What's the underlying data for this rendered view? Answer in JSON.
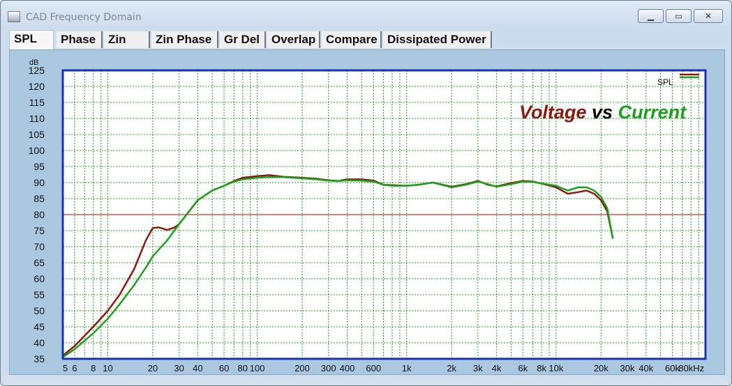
{
  "window": {
    "title": "CAD Frequency Domain"
  },
  "tabs": [
    "SPL",
    "Phase",
    "Zin",
    "Zin Phase",
    "Gr Del",
    "Overlap",
    "Compare",
    "Dissipated Power"
  ],
  "active_tab": "SPL",
  "annotation": {
    "part1": "Voltage",
    "part2": " vs ",
    "part3": "Current"
  },
  "colors": {
    "voltage": "#8b1a10",
    "current": "#1ea01e",
    "grid": "#1a9a1a",
    "reference": "#c0392b",
    "frame": "#1833b0"
  },
  "chart_data": {
    "type": "line",
    "title": "",
    "ylabel": "dB",
    "xlabel": "",
    "x_scale": "log",
    "xlim": [
      5,
      100000
    ],
    "ylim": [
      35,
      125
    ],
    "y_ticks": [
      35,
      40,
      45,
      50,
      55,
      60,
      65,
      70,
      75,
      80,
      85,
      90,
      95,
      100,
      105,
      110,
      115,
      120,
      125
    ],
    "x_tick_labels": [
      {
        "x": 5,
        "label": "5"
      },
      {
        "x": 6,
        "label": "6"
      },
      {
        "x": 8,
        "label": "8"
      },
      {
        "x": 10,
        "label": "10"
      },
      {
        "x": 20,
        "label": "20"
      },
      {
        "x": 30,
        "label": "30"
      },
      {
        "x": 40,
        "label": "40"
      },
      {
        "x": 60,
        "label": "60"
      },
      {
        "x": 80,
        "label": "80"
      },
      {
        "x": 100,
        "label": "100"
      },
      {
        "x": 200,
        "label": "200"
      },
      {
        "x": 300,
        "label": "300"
      },
      {
        "x": 400,
        "label": "400"
      },
      {
        "x": 600,
        "label": "600"
      },
      {
        "x": 1000,
        "label": "1k"
      },
      {
        "x": 2000,
        "label": "2k"
      },
      {
        "x": 3000,
        "label": "3k"
      },
      {
        "x": 4000,
        "label": "4k"
      },
      {
        "x": 6000,
        "label": "6k"
      },
      {
        "x": 8000,
        "label": "8k"
      },
      {
        "x": 10000,
        "label": "10k"
      },
      {
        "x": 20000,
        "label": "20k"
      },
      {
        "x": 30000,
        "label": "30k"
      },
      {
        "x": 40000,
        "label": "40k"
      },
      {
        "x": 60000,
        "label": "60k"
      },
      {
        "x": 80000,
        "label": "80kHz"
      }
    ],
    "reference_line": 80,
    "legend": {
      "label": "SPL",
      "position": "top-right"
    },
    "grid": true,
    "series": [
      {
        "name": "Voltage",
        "color": "#8b1a10",
        "points": [
          [
            5,
            36
          ],
          [
            6,
            39
          ],
          [
            8,
            45
          ],
          [
            10,
            50
          ],
          [
            12,
            55
          ],
          [
            15,
            63
          ],
          [
            18,
            72
          ],
          [
            20,
            75.8
          ],
          [
            22,
            76
          ],
          [
            25,
            75.2
          ],
          [
            28,
            76
          ],
          [
            30,
            77
          ],
          [
            35,
            81
          ],
          [
            40,
            84.5
          ],
          [
            50,
            87.5
          ],
          [
            60,
            89
          ],
          [
            70,
            90.5
          ],
          [
            80,
            91.5
          ],
          [
            100,
            92
          ],
          [
            120,
            92.3
          ],
          [
            150,
            91.8
          ],
          [
            200,
            91.5
          ],
          [
            250,
            91.2
          ],
          [
            300,
            90.7
          ],
          [
            350,
            90.5
          ],
          [
            400,
            91
          ],
          [
            500,
            91
          ],
          [
            600,
            90.6
          ],
          [
            700,
            89.3
          ],
          [
            800,
            89.2
          ],
          [
            1000,
            89
          ],
          [
            1200,
            89.3
          ],
          [
            1500,
            90
          ],
          [
            2000,
            88.7
          ],
          [
            2500,
            89.5
          ],
          [
            3000,
            90.5
          ],
          [
            3500,
            89.3
          ],
          [
            4000,
            88.8
          ],
          [
            5000,
            89.8
          ],
          [
            6000,
            90.5
          ],
          [
            7000,
            90.3
          ],
          [
            8000,
            89.7
          ],
          [
            10000,
            88.5
          ],
          [
            12000,
            86.5
          ],
          [
            14000,
            87
          ],
          [
            16000,
            87.5
          ],
          [
            18000,
            86.5
          ],
          [
            20000,
            84.5
          ],
          [
            22000,
            81
          ],
          [
            24000,
            72.5
          ]
        ]
      },
      {
        "name": "Current",
        "color": "#1ea01e",
        "points": [
          [
            5,
            35.5
          ],
          [
            6,
            38
          ],
          [
            8,
            43
          ],
          [
            10,
            47.5
          ],
          [
            12,
            52
          ],
          [
            15,
            58
          ],
          [
            18,
            63.5
          ],
          [
            20,
            67
          ],
          [
            25,
            72
          ],
          [
            30,
            77
          ],
          [
            35,
            81
          ],
          [
            40,
            84.5
          ],
          [
            50,
            87.5
          ],
          [
            60,
            89
          ],
          [
            70,
            90.3
          ],
          [
            80,
            91
          ],
          [
            100,
            91.5
          ],
          [
            120,
            91.7
          ],
          [
            150,
            91.7
          ],
          [
            200,
            91.3
          ],
          [
            250,
            91
          ],
          [
            300,
            90.6
          ],
          [
            350,
            90.5
          ],
          [
            400,
            90.7
          ],
          [
            500,
            90.6
          ],
          [
            600,
            90.3
          ],
          [
            700,
            89.3
          ],
          [
            800,
            89
          ],
          [
            1000,
            89
          ],
          [
            1200,
            89.3
          ],
          [
            1500,
            90
          ],
          [
            2000,
            88.5
          ],
          [
            2500,
            89.3
          ],
          [
            3000,
            90.3
          ],
          [
            3500,
            89.5
          ],
          [
            4000,
            88.7
          ],
          [
            5000,
            89.5
          ],
          [
            6000,
            90.3
          ],
          [
            7000,
            90.2
          ],
          [
            8000,
            89.7
          ],
          [
            10000,
            89
          ],
          [
            12000,
            87.5
          ],
          [
            14000,
            88.5
          ],
          [
            16000,
            88.5
          ],
          [
            18000,
            87.5
          ],
          [
            20000,
            85.5
          ],
          [
            22000,
            82
          ],
          [
            24000,
            72.5
          ]
        ]
      }
    ]
  }
}
